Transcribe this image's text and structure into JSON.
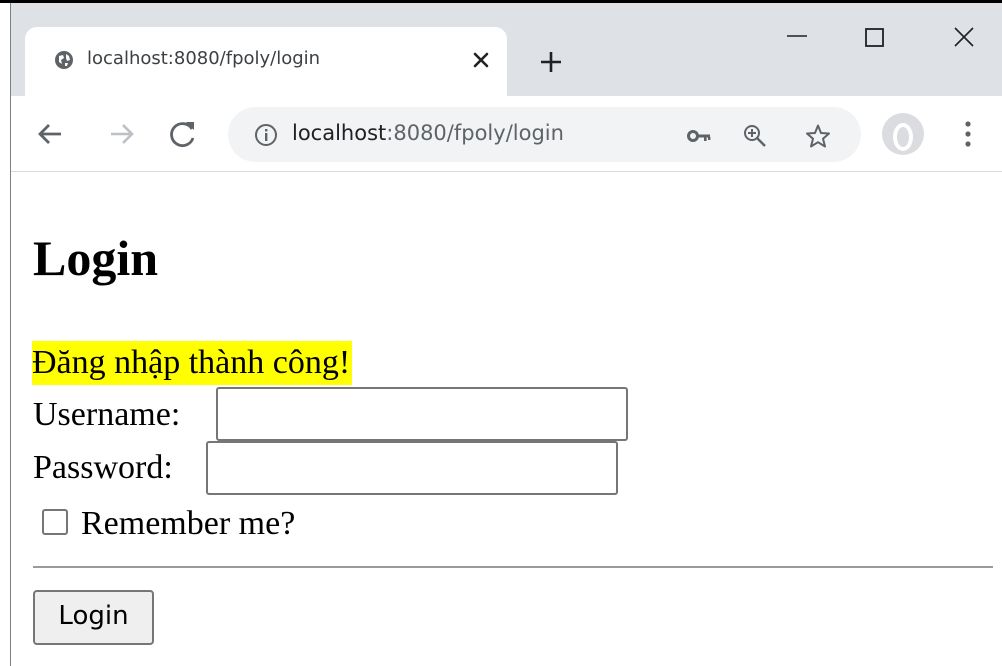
{
  "browser": {
    "tab": {
      "title": "localhost:8080/fpoly/login",
      "favicon": "globe-icon",
      "close_icon": "close-icon"
    },
    "new_tab_icon": "plus-icon",
    "window_controls": [
      "minimize-icon",
      "maximize-icon",
      "close-icon"
    ],
    "toolbar": {
      "back_icon": "arrow-left-icon",
      "forward_icon": "arrow-right-icon",
      "reload_icon": "reload-icon",
      "site_info_icon": "info-icon",
      "url_host": "localhost",
      "url_rest": ":8080/fpoly/login",
      "right_icons": [
        "key-icon",
        "zoom-icon",
        "star-icon"
      ],
      "profile_icon": "avatar",
      "menu_icon": "kebab-menu-icon"
    }
  },
  "page": {
    "title": "Login",
    "message": "Đăng nhập thành công!",
    "message_highlight_color": "#ffff00",
    "username_label": "Username:",
    "username_value": "",
    "password_label": "Password:",
    "password_value": "",
    "remember_label": "Remember me?",
    "remember_checked": false,
    "login_button": "Login"
  }
}
